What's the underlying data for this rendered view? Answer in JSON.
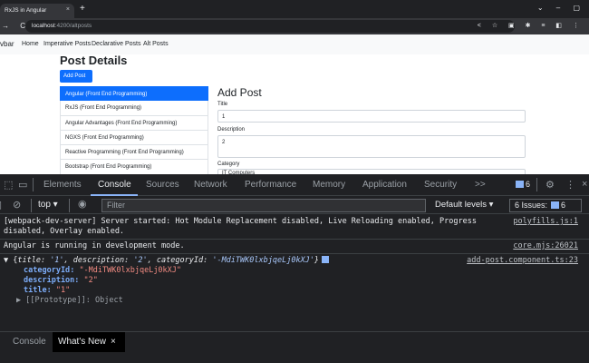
{
  "browser": {
    "tab_title": "RxJS in Angular",
    "tab_close": "×",
    "new_tab": "+",
    "window_controls": "⌄ – ▢",
    "nav_buttons": "→ C ⓘ",
    "url_host": "localhost",
    "url_path": ":4200/altposts",
    "toolbar_icons": "< ☆ ▣ ✱ ≡ ◧ ⋮"
  },
  "appnav": {
    "brand": "vbar",
    "links": [
      "Home",
      "Imperative Posts",
      "Declarative Posts",
      "Alt Posts"
    ]
  },
  "page": {
    "title": "Post Details",
    "add_button": "Add Post",
    "posts": [
      "Angular (Front End Programming)",
      "RxJS (Front End Programming)",
      "Angular Advantages (Front End Programming)",
      "NGXS (Front End Programming)",
      "Reactive Programming (Front End Programming)",
      "Bootstrap (Front End Programming)"
    ],
    "form_title": "Add Post",
    "title_label": "Title",
    "title_value": "1",
    "description_label": "Description",
    "description_value": "2",
    "category_label": "Category",
    "category_value": "IT Computers"
  },
  "devtools": {
    "tabs": [
      "Elements",
      "Console",
      "Sources",
      "Network",
      "Performance",
      "Memory",
      "Application",
      "Security",
      ">>"
    ],
    "active_tab": "Console",
    "issues_count": "6",
    "context": "top ▾",
    "filter_placeholder": "Filter",
    "levels": "Default levels ▾",
    "issues_label": "6 Issues:",
    "issues_count2": "6",
    "messages": {
      "m1_text": "[webpack-dev-server] Server started: Hot Module Replacement disabled, Live Reloading enabled, Progress disabled, Overlay enabled.",
      "m1_src": "polyfills.js:1",
      "m2_text": "Angular is running in development mode.",
      "m2_src": "core.mjs:26021",
      "m3_src": "add-post.component.ts:23",
      "obj_summary_open": "▼ {",
      "obj_summary_k1": "title: ",
      "obj_summary_v1": "'1'",
      "obj_summary_k2": ", description: ",
      "obj_summary_v2": "'2'",
      "obj_summary_k3": ", categoryId: ",
      "obj_summary_v3": "'-MdiTWK0lxbjqeLj0kXJ'",
      "obj_summary_close": "}",
      "prop1_key": "categoryId",
      "prop1_val": "\"-MdiTWK0lxbjqeLj0kXJ\"",
      "prop2_key": "description",
      "prop2_val": "\"2\"",
      "prop3_key": "title",
      "prop3_val": "\"1\"",
      "proto": "▶ [[Prototype]]: Object"
    },
    "drawer_tabs": [
      "Console",
      "What's New"
    ],
    "drawer_close": "×"
  },
  "colors": {
    "primary": "#0d6efd",
    "devtools_bg": "#202124",
    "link_blue": "#8ab4f8"
  }
}
